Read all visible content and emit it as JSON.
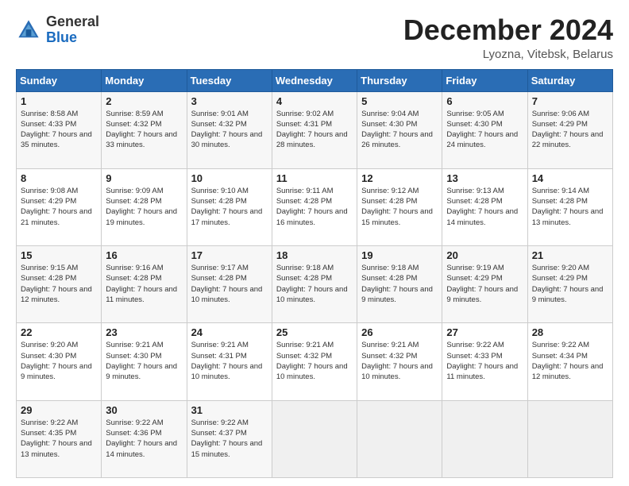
{
  "logo": {
    "general": "General",
    "blue": "Blue"
  },
  "header": {
    "month": "December 2024",
    "location": "Lyozna, Vitebsk, Belarus"
  },
  "weekdays": [
    "Sunday",
    "Monday",
    "Tuesday",
    "Wednesday",
    "Thursday",
    "Friday",
    "Saturday"
  ],
  "weeks": [
    [
      {
        "day": "1",
        "sunrise": "Sunrise: 8:58 AM",
        "sunset": "Sunset: 4:33 PM",
        "daylight": "Daylight: 7 hours and 35 minutes."
      },
      {
        "day": "2",
        "sunrise": "Sunrise: 8:59 AM",
        "sunset": "Sunset: 4:32 PM",
        "daylight": "Daylight: 7 hours and 33 minutes."
      },
      {
        "day": "3",
        "sunrise": "Sunrise: 9:01 AM",
        "sunset": "Sunset: 4:32 PM",
        "daylight": "Daylight: 7 hours and 30 minutes."
      },
      {
        "day": "4",
        "sunrise": "Sunrise: 9:02 AM",
        "sunset": "Sunset: 4:31 PM",
        "daylight": "Daylight: 7 hours and 28 minutes."
      },
      {
        "day": "5",
        "sunrise": "Sunrise: 9:04 AM",
        "sunset": "Sunset: 4:30 PM",
        "daylight": "Daylight: 7 hours and 26 minutes."
      },
      {
        "day": "6",
        "sunrise": "Sunrise: 9:05 AM",
        "sunset": "Sunset: 4:30 PM",
        "daylight": "Daylight: 7 hours and 24 minutes."
      },
      {
        "day": "7",
        "sunrise": "Sunrise: 9:06 AM",
        "sunset": "Sunset: 4:29 PM",
        "daylight": "Daylight: 7 hours and 22 minutes."
      }
    ],
    [
      {
        "day": "8",
        "sunrise": "Sunrise: 9:08 AM",
        "sunset": "Sunset: 4:29 PM",
        "daylight": "Daylight: 7 hours and 21 minutes."
      },
      {
        "day": "9",
        "sunrise": "Sunrise: 9:09 AM",
        "sunset": "Sunset: 4:28 PM",
        "daylight": "Daylight: 7 hours and 19 minutes."
      },
      {
        "day": "10",
        "sunrise": "Sunrise: 9:10 AM",
        "sunset": "Sunset: 4:28 PM",
        "daylight": "Daylight: 7 hours and 17 minutes."
      },
      {
        "day": "11",
        "sunrise": "Sunrise: 9:11 AM",
        "sunset": "Sunset: 4:28 PM",
        "daylight": "Daylight: 7 hours and 16 minutes."
      },
      {
        "day": "12",
        "sunrise": "Sunrise: 9:12 AM",
        "sunset": "Sunset: 4:28 PM",
        "daylight": "Daylight: 7 hours and 15 minutes."
      },
      {
        "day": "13",
        "sunrise": "Sunrise: 9:13 AM",
        "sunset": "Sunset: 4:28 PM",
        "daylight": "Daylight: 7 hours and 14 minutes."
      },
      {
        "day": "14",
        "sunrise": "Sunrise: 9:14 AM",
        "sunset": "Sunset: 4:28 PM",
        "daylight": "Daylight: 7 hours and 13 minutes."
      }
    ],
    [
      {
        "day": "15",
        "sunrise": "Sunrise: 9:15 AM",
        "sunset": "Sunset: 4:28 PM",
        "daylight": "Daylight: 7 hours and 12 minutes."
      },
      {
        "day": "16",
        "sunrise": "Sunrise: 9:16 AM",
        "sunset": "Sunset: 4:28 PM",
        "daylight": "Daylight: 7 hours and 11 minutes."
      },
      {
        "day": "17",
        "sunrise": "Sunrise: 9:17 AM",
        "sunset": "Sunset: 4:28 PM",
        "daylight": "Daylight: 7 hours and 10 minutes."
      },
      {
        "day": "18",
        "sunrise": "Sunrise: 9:18 AM",
        "sunset": "Sunset: 4:28 PM",
        "daylight": "Daylight: 7 hours and 10 minutes."
      },
      {
        "day": "19",
        "sunrise": "Sunrise: 9:18 AM",
        "sunset": "Sunset: 4:28 PM",
        "daylight": "Daylight: 7 hours and 9 minutes."
      },
      {
        "day": "20",
        "sunrise": "Sunrise: 9:19 AM",
        "sunset": "Sunset: 4:29 PM",
        "daylight": "Daylight: 7 hours and 9 minutes."
      },
      {
        "day": "21",
        "sunrise": "Sunrise: 9:20 AM",
        "sunset": "Sunset: 4:29 PM",
        "daylight": "Daylight: 7 hours and 9 minutes."
      }
    ],
    [
      {
        "day": "22",
        "sunrise": "Sunrise: 9:20 AM",
        "sunset": "Sunset: 4:30 PM",
        "daylight": "Daylight: 7 hours and 9 minutes."
      },
      {
        "day": "23",
        "sunrise": "Sunrise: 9:21 AM",
        "sunset": "Sunset: 4:30 PM",
        "daylight": "Daylight: 7 hours and 9 minutes."
      },
      {
        "day": "24",
        "sunrise": "Sunrise: 9:21 AM",
        "sunset": "Sunset: 4:31 PM",
        "daylight": "Daylight: 7 hours and 10 minutes."
      },
      {
        "day": "25",
        "sunrise": "Sunrise: 9:21 AM",
        "sunset": "Sunset: 4:32 PM",
        "daylight": "Daylight: 7 hours and 10 minutes."
      },
      {
        "day": "26",
        "sunrise": "Sunrise: 9:21 AM",
        "sunset": "Sunset: 4:32 PM",
        "daylight": "Daylight: 7 hours and 10 minutes."
      },
      {
        "day": "27",
        "sunrise": "Sunrise: 9:22 AM",
        "sunset": "Sunset: 4:33 PM",
        "daylight": "Daylight: 7 hours and 11 minutes."
      },
      {
        "day": "28",
        "sunrise": "Sunrise: 9:22 AM",
        "sunset": "Sunset: 4:34 PM",
        "daylight": "Daylight: 7 hours and 12 minutes."
      }
    ],
    [
      {
        "day": "29",
        "sunrise": "Sunrise: 9:22 AM",
        "sunset": "Sunset: 4:35 PM",
        "daylight": "Daylight: 7 hours and 13 minutes."
      },
      {
        "day": "30",
        "sunrise": "Sunrise: 9:22 AM",
        "sunset": "Sunset: 4:36 PM",
        "daylight": "Daylight: 7 hours and 14 minutes."
      },
      {
        "day": "31",
        "sunrise": "Sunrise: 9:22 AM",
        "sunset": "Sunset: 4:37 PM",
        "daylight": "Daylight: 7 hours and 15 minutes."
      },
      null,
      null,
      null,
      null
    ]
  ]
}
